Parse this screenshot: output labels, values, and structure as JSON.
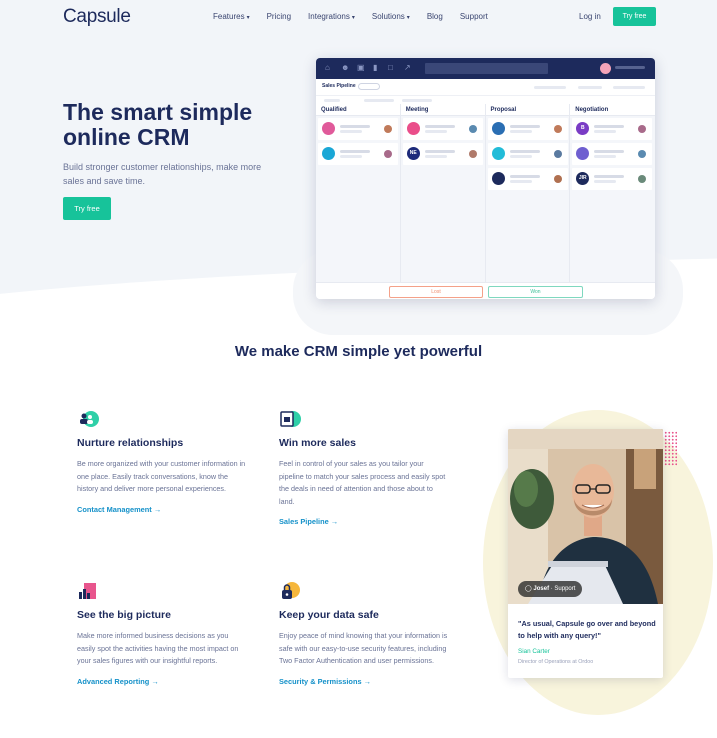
{
  "nav": {
    "logo": "Capsule",
    "links": [
      {
        "label": "Features",
        "dropdown": true
      },
      {
        "label": "Pricing",
        "dropdown": false
      },
      {
        "label": "Integrations",
        "dropdown": true
      },
      {
        "label": "Solutions",
        "dropdown": true
      },
      {
        "label": "Blog",
        "dropdown": false
      },
      {
        "label": "Support",
        "dropdown": false
      }
    ],
    "login": "Log in",
    "try_free": "Try free"
  },
  "hero": {
    "title": "The smart simple online CRM",
    "subtitle": "Build stronger customer relationships, make more sales and save time.",
    "cta": "Try free"
  },
  "mock": {
    "pipeline_label": "Sales Pipeline",
    "columns": [
      {
        "name": "Qualified",
        "cards": [
          {
            "badge": "",
            "color": "#e05a9a"
          },
          {
            "badge": "",
            "color": "#1aa7d6"
          }
        ]
      },
      {
        "name": "Meeting",
        "cards": [
          {
            "badge": "",
            "color": "#ea4e8a"
          },
          {
            "badge": "NE",
            "color": "#1d2a7a"
          }
        ]
      },
      {
        "name": "Proposal",
        "cards": [
          {
            "badge": "",
            "color": "#2a6eb3"
          },
          {
            "badge": "",
            "color": "#22bcd8"
          },
          {
            "badge": "",
            "color": "#1d2a5c"
          }
        ]
      },
      {
        "name": "Negotiation",
        "cards": [
          {
            "badge": "B",
            "color": "#7a3cc5"
          },
          {
            "badge": "",
            "color": "#6f5fd0"
          },
          {
            "badge": "JIR",
            "color": "#1d2a5c"
          }
        ]
      }
    ],
    "lost": "Lost",
    "won": "Won"
  },
  "section": {
    "title": "We make CRM simple yet powerful"
  },
  "features": [
    {
      "title": "Nurture relationships",
      "text": "Be more organized with your customer information in one place. Easily track conversations, know the history and deliver more personal experiences.",
      "link": "Contact Management",
      "icon": "people-icon"
    },
    {
      "title": "Win more sales",
      "text": "Feel in control of your sales as you tailor your pipeline to match your sales process and easily spot the deals in need of attention and those about to land.",
      "link": "Sales Pipeline",
      "icon": "pipeline-icon"
    },
    {
      "title": "See the big picture",
      "text": "Make more informed business decisions as you easily spot the activities having the most impact on your sales figures with our insightful reports.",
      "link": "Advanced Reporting",
      "icon": "chart-icon"
    },
    {
      "title": "Keep your data safe",
      "text": "Enjoy peace of mind knowing that your information is safe with our easy-to-use security features, including Two Factor Authentication and user permissions.",
      "link": "Security & Permissions",
      "icon": "lock-icon"
    }
  ],
  "testimonial": {
    "tag_name": "Josef",
    "tag_role": "· Support",
    "quote": "\"As usual, Capsule go over and beyond to help with any query!\"",
    "name": "Sian Carter",
    "role": "Director of Operations at Ordoo"
  },
  "colors": {
    "brand_navy": "#1d2a5c",
    "accent_green": "#17c39a",
    "link_blue": "#1591c9"
  }
}
